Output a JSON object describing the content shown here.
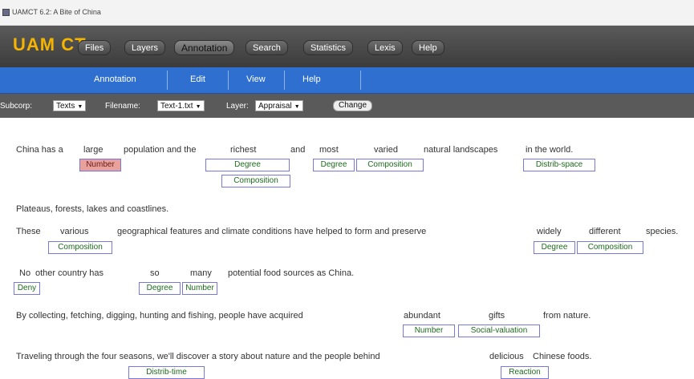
{
  "window": {
    "title": "UAMCT 6.2: A Bite of China"
  },
  "toolbar": {
    "logo": "UAM CT",
    "tabs": [
      "Files",
      "Layers",
      "Annotation",
      "Search",
      "Statistics",
      "Lexis",
      "Help"
    ],
    "active_tab": "Annotation"
  },
  "submenu": {
    "items": [
      "Annotation",
      "Edit",
      "View",
      "Help"
    ]
  },
  "corpus_bar": {
    "subcorp_label": "Subcorp:",
    "subcorp_value": "Texts",
    "filename_label": "Filename:",
    "filename_value": "Text-1.txt",
    "layer_label": "Layer:",
    "layer_value": "Appraisal",
    "change_button": "Change"
  },
  "lines": [
    {
      "words": [
        "China has a",
        "large",
        "population and the",
        "richest",
        "and",
        "most",
        "varied",
        "natural landscapes",
        "in the world."
      ],
      "tags": [
        "Number",
        "Degree",
        "Composition",
        "Degree",
        "Composition",
        "Distrib-space"
      ]
    },
    {
      "words": [
        "Plateaus, forests, lakes and coastlines."
      ],
      "tags": []
    },
    {
      "words": [
        "These",
        "various",
        "geographical features and climate conditions have helped to form and preserve",
        "widely",
        "different",
        "species."
      ],
      "tags": [
        "Composition",
        "Degree",
        "Composition"
      ]
    },
    {
      "words": [
        "No",
        "other country has",
        "so",
        "many",
        "potential food sources as China."
      ],
      "tags": [
        "Deny",
        "Degree",
        "Number"
      ]
    },
    {
      "words": [
        "By collecting, fetching, digging, hunting and fishing, people have acquired",
        "abundant",
        "gifts",
        "from nature."
      ],
      "tags": [
        "Number",
        "Social-valuation"
      ]
    },
    {
      "words": [
        "Traveling through the four seasons, we'll discover a story about nature and the people behind",
        "delicious",
        "Chinese foods."
      ],
      "tags": [
        "Distrib-time",
        "Reaction"
      ]
    }
  ]
}
